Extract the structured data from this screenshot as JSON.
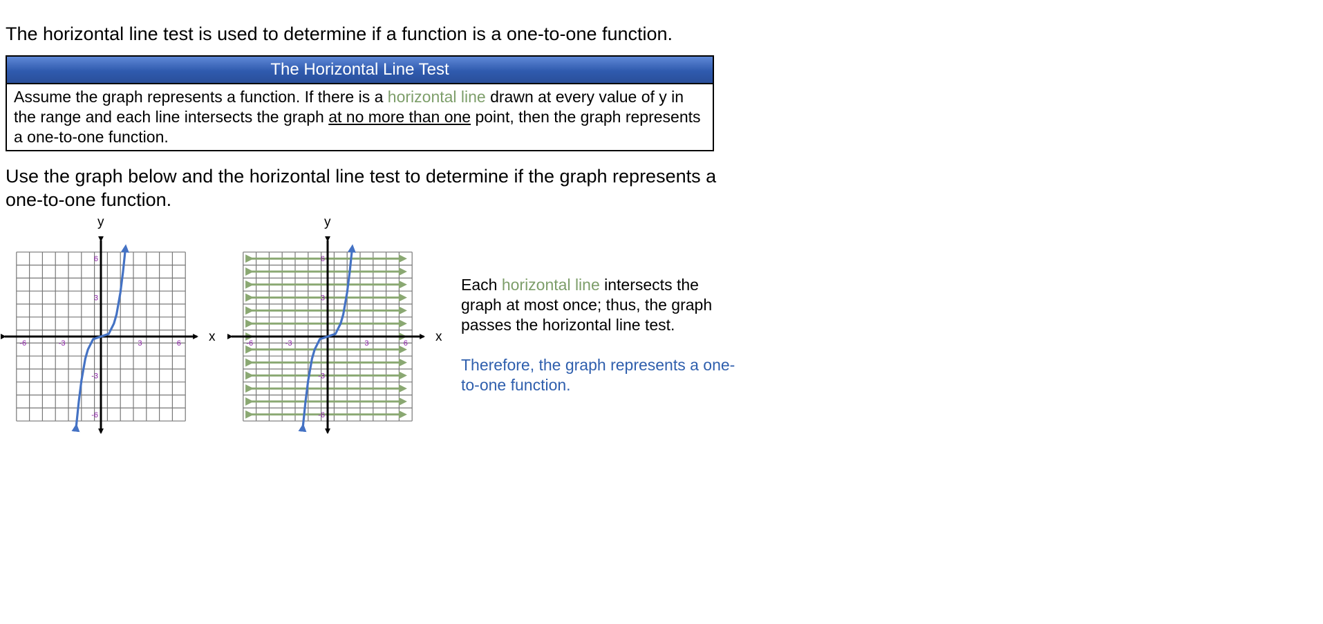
{
  "intro": "The horizontal line test is used to determine if a function is a one-to-one function.",
  "box": {
    "title": "The Horizontal Line Test",
    "body_1": "Assume the graph represents a function.  If there is a ",
    "body_green": "horizontal line",
    "body_2": " drawn at every value of y in the range and each line intersects the graph ",
    "body_underlined": "at no more than one",
    "body_3": " point, then the graph represents a one-to-one function."
  },
  "instruction": "Use the graph below and the horizontal line test to determine if the graph represents a one-to-one function.",
  "graphs": {
    "x_axis_label": "x",
    "y_axis_label": "y",
    "x_tick_labels": [
      "-6",
      "-3",
      "3",
      "6"
    ],
    "y_tick_labels": [
      "6",
      "3",
      "-3",
      "-6"
    ],
    "curve_color": "#4472c4",
    "line_color": "#8aa872",
    "tick_label_color": "#8b1fa6"
  },
  "chart_data": [
    {
      "type": "line",
      "title": "",
      "xlabel": "x",
      "ylabel": "y",
      "xlim": [
        -7,
        7
      ],
      "ylim": [
        -7,
        7
      ],
      "grid": true,
      "series": [
        {
          "x": [
            -1.9,
            -1.7,
            -1.5,
            -1.2,
            -1.0,
            -0.6,
            0,
            0.6,
            1.0,
            1.2,
            1.5,
            1.7,
            1.9
          ],
          "values": [
            -6.9,
            -5.0,
            -3.4,
            -1.7,
            -1.0,
            -0.2,
            0,
            0.2,
            1.0,
            1.7,
            3.4,
            5.0,
            6.9
          ]
        }
      ]
    },
    {
      "type": "line",
      "title": "",
      "xlabel": "x",
      "ylabel": "y",
      "xlim": [
        -7,
        7
      ],
      "ylim": [
        -7,
        7
      ],
      "grid": true,
      "horizontal_lines_y": [
        6,
        5,
        4,
        3,
        2,
        1,
        0,
        -1,
        -2,
        -3,
        -4,
        -5,
        -6
      ],
      "series": [
        {
          "x": [
            -1.9,
            -1.7,
            -1.5,
            -1.2,
            -1.0,
            -0.6,
            0,
            0.6,
            1.0,
            1.2,
            1.5,
            1.7,
            1.9
          ],
          "values": [
            -6.9,
            -5.0,
            -3.4,
            -1.7,
            -1.0,
            -0.2,
            0,
            0.2,
            1.0,
            1.7,
            3.4,
            5.0,
            6.9
          ]
        }
      ]
    }
  ],
  "explanation": {
    "part_1": "Each ",
    "green": "horizontal line",
    "part_2": " intersects the graph at most once; thus, the graph passes the horizontal line test."
  },
  "conclusion": "Therefore, the graph represents a one-to-one function."
}
